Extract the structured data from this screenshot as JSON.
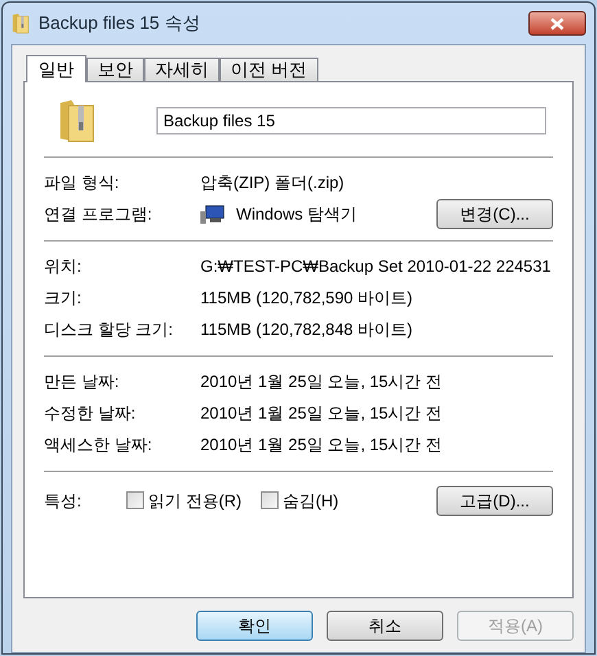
{
  "window": {
    "title": "Backup files 15 속성"
  },
  "tabs": [
    {
      "label": "일반",
      "selected": true
    },
    {
      "label": "보안",
      "selected": false
    },
    {
      "label": "자세히",
      "selected": false
    },
    {
      "label": "이전 버전",
      "selected": false
    }
  ],
  "name_field": {
    "value": "Backup files 15"
  },
  "sections": [
    {
      "rows": [
        {
          "label": "파일 형식:",
          "value": "압축(ZIP) 폴더(.zip)"
        },
        {
          "label": "연결 프로그램:",
          "value": "Windows 탐색기",
          "kind": "program",
          "button": "변경(C)..."
        }
      ]
    },
    {
      "rows": [
        {
          "label": "위치:",
          "value": "G:₩TEST-PC₩Backup Set 2010-01-22 224531"
        },
        {
          "label": "크기:",
          "value": "115MB (120,782,590 바이트)"
        },
        {
          "label": "디스크 할당 크기:",
          "value": "115MB (120,782,848 바이트)"
        }
      ]
    },
    {
      "rows": [
        {
          "label": "만든 날짜:",
          "value": "2010년 1월 25일 오늘, 15시간 전"
        },
        {
          "label": "수정한 날짜:",
          "value": "2010년 1월 25일 오늘, 15시간 전"
        },
        {
          "label": "액세스한 날짜:",
          "value": "2010년 1월 25일 오늘, 15시간 전"
        }
      ]
    }
  ],
  "attributes": {
    "label": "특성:",
    "checkboxes": [
      {
        "label": "읽기 전용(R)",
        "checked": false
      },
      {
        "label": "숨김(H)",
        "checked": false
      }
    ],
    "button": "고급(D)..."
  },
  "buttons": [
    {
      "label": "확인",
      "default": true,
      "disabled": false
    },
    {
      "label": "취소",
      "default": false,
      "disabled": false
    },
    {
      "label": "적용(A)",
      "default": false,
      "disabled": true
    }
  ]
}
